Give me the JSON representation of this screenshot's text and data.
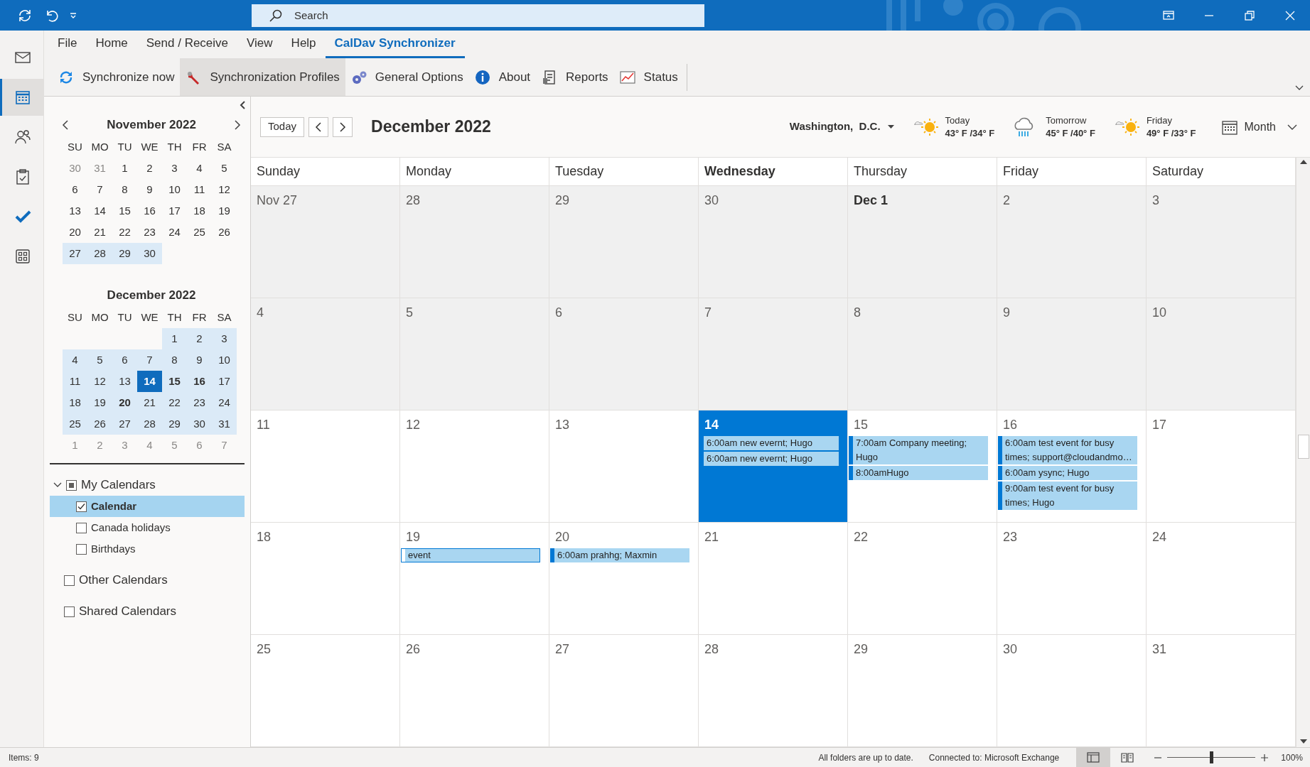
{
  "title_bar": {
    "search": {
      "placeholder": "Search"
    }
  },
  "nav_items": [
    {
      "kind": "mail",
      "selected": false
    },
    {
      "kind": "calendar",
      "selected": true
    },
    {
      "kind": "people",
      "selected": false
    },
    {
      "kind": "tasks",
      "selected": false
    },
    {
      "kind": "todo",
      "selected": false
    },
    {
      "kind": "apps",
      "selected": false
    }
  ],
  "menu_tabs": [
    {
      "label": "File",
      "selected": false
    },
    {
      "label": "Home",
      "selected": false
    },
    {
      "label": "Send / Receive",
      "selected": false
    },
    {
      "label": "View",
      "selected": false
    },
    {
      "label": "Help",
      "selected": false
    },
    {
      "label": "CalDav Synchronizer",
      "selected": true
    }
  ],
  "ribbon_buttons": [
    {
      "kind": "sync",
      "label": "Synchronize now",
      "hovered": false
    },
    {
      "kind": "wrench",
      "label": "Synchronization Profiles",
      "hovered": true
    },
    {
      "kind": "gears",
      "label": "General Options",
      "hovered": false
    },
    {
      "kind": "info",
      "label": "About",
      "hovered": false
    },
    {
      "kind": "reports",
      "label": "Reports",
      "hovered": false
    },
    {
      "kind": "status",
      "label": "Status",
      "hovered": false
    }
  ],
  "mini_calendars": [
    {
      "title": "November 2022",
      "weekdays": [
        "SU",
        "MO",
        "TU",
        "WE",
        "TH",
        "FR",
        "SA"
      ],
      "weeks": [
        [
          {
            "day": "30",
            "muted": true,
            "highlighted": false,
            "bold": false,
            "selected": false
          },
          {
            "day": "31",
            "muted": true,
            "highlighted": false,
            "bold": false,
            "selected": false
          },
          {
            "day": "1",
            "muted": false,
            "highlighted": false,
            "bold": false,
            "selected": false
          },
          {
            "day": "2",
            "muted": false,
            "highlighted": false,
            "bold": false,
            "selected": false
          },
          {
            "day": "3",
            "muted": false,
            "highlighted": false,
            "bold": false,
            "selected": false
          },
          {
            "day": "4",
            "muted": false,
            "highlighted": false,
            "bold": false,
            "selected": false
          },
          {
            "day": "5",
            "muted": false,
            "highlighted": false,
            "bold": false,
            "selected": false
          }
        ],
        [
          {
            "day": "6",
            "muted": false,
            "highlighted": false,
            "bold": false,
            "selected": false
          },
          {
            "day": "7",
            "muted": false,
            "highlighted": false,
            "bold": false,
            "selected": false
          },
          {
            "day": "8",
            "muted": false,
            "highlighted": false,
            "bold": false,
            "selected": false
          },
          {
            "day": "9",
            "muted": false,
            "highlighted": false,
            "bold": false,
            "selected": false
          },
          {
            "day": "10",
            "muted": false,
            "highlighted": false,
            "bold": false,
            "selected": false
          },
          {
            "day": "11",
            "muted": false,
            "highlighted": false,
            "bold": false,
            "selected": false
          },
          {
            "day": "12",
            "muted": false,
            "highlighted": false,
            "bold": false,
            "selected": false
          }
        ],
        [
          {
            "day": "13",
            "muted": false,
            "highlighted": false,
            "bold": false,
            "selected": false
          },
          {
            "day": "14",
            "muted": false,
            "highlighted": false,
            "bold": false,
            "selected": false
          },
          {
            "day": "15",
            "muted": false,
            "highlighted": false,
            "bold": false,
            "selected": false
          },
          {
            "day": "16",
            "muted": false,
            "highlighted": false,
            "bold": false,
            "selected": false
          },
          {
            "day": "17",
            "muted": false,
            "highlighted": false,
            "bold": false,
            "selected": false
          },
          {
            "day": "18",
            "muted": false,
            "highlighted": false,
            "bold": false,
            "selected": false
          },
          {
            "day": "19",
            "muted": false,
            "highlighted": false,
            "bold": false,
            "selected": false
          }
        ],
        [
          {
            "day": "20",
            "muted": false,
            "highlighted": false,
            "bold": false,
            "selected": false
          },
          {
            "day": "21",
            "muted": false,
            "highlighted": false,
            "bold": false,
            "selected": false
          },
          {
            "day": "22",
            "muted": false,
            "highlighted": false,
            "bold": false,
            "selected": false
          },
          {
            "day": "23",
            "muted": false,
            "highlighted": false,
            "bold": false,
            "selected": false
          },
          {
            "day": "24",
            "muted": false,
            "highlighted": false,
            "bold": false,
            "selected": false
          },
          {
            "day": "25",
            "muted": false,
            "highlighted": false,
            "bold": false,
            "selected": false
          },
          {
            "day": "26",
            "muted": false,
            "highlighted": false,
            "bold": false,
            "selected": false
          }
        ],
        [
          {
            "day": "27",
            "muted": false,
            "highlighted": true,
            "bold": false,
            "selected": false
          },
          {
            "day": "28",
            "muted": false,
            "highlighted": true,
            "bold": false,
            "selected": false
          },
          {
            "day": "29",
            "muted": false,
            "highlighted": true,
            "bold": false,
            "selected": false
          },
          {
            "day": "30",
            "muted": false,
            "highlighted": true,
            "bold": false,
            "selected": false
          }
        ]
      ]
    },
    {
      "title": "December 2022",
      "weekdays": [
        "SU",
        "MO",
        "TU",
        "WE",
        "TH",
        "FR",
        "SA"
      ],
      "weeks": [
        [
          {
            "day": "1",
            "muted": false,
            "highlighted": true,
            "bold": false,
            "selected": false
          },
          {
            "day": "2",
            "muted": false,
            "highlighted": true,
            "bold": false,
            "selected": false
          },
          {
            "day": "3",
            "muted": false,
            "highlighted": true,
            "bold": false,
            "selected": false
          }
        ],
        [
          {
            "day": "4",
            "muted": false,
            "highlighted": true,
            "bold": false,
            "selected": false
          },
          {
            "day": "5",
            "muted": false,
            "highlighted": true,
            "bold": false,
            "selected": false
          },
          {
            "day": "6",
            "muted": false,
            "highlighted": true,
            "bold": false,
            "selected": false
          },
          {
            "day": "7",
            "muted": false,
            "highlighted": true,
            "bold": false,
            "selected": false
          },
          {
            "day": "8",
            "muted": false,
            "highlighted": true,
            "bold": false,
            "selected": false
          },
          {
            "day": "9",
            "muted": false,
            "highlighted": true,
            "bold": false,
            "selected": false
          },
          {
            "day": "10",
            "muted": false,
            "highlighted": true,
            "bold": false,
            "selected": false
          }
        ],
        [
          {
            "day": "11",
            "muted": false,
            "highlighted": true,
            "bold": false,
            "selected": false
          },
          {
            "day": "12",
            "muted": false,
            "highlighted": true,
            "bold": false,
            "selected": false
          },
          {
            "day": "13",
            "muted": false,
            "highlighted": true,
            "bold": false,
            "selected": false
          },
          {
            "day": "14",
            "muted": false,
            "highlighted": true,
            "bold": true,
            "selected": true
          },
          {
            "day": "15",
            "muted": false,
            "highlighted": true,
            "bold": true,
            "selected": false
          },
          {
            "day": "16",
            "muted": false,
            "highlighted": true,
            "bold": true,
            "selected": false
          },
          {
            "day": "17",
            "muted": false,
            "highlighted": true,
            "bold": false,
            "selected": false
          }
        ],
        [
          {
            "day": "18",
            "muted": false,
            "highlighted": true,
            "bold": false,
            "selected": false
          },
          {
            "day": "19",
            "muted": false,
            "highlighted": true,
            "bold": false,
            "selected": false
          },
          {
            "day": "20",
            "muted": false,
            "highlighted": true,
            "bold": true,
            "selected": false
          },
          {
            "day": "21",
            "muted": false,
            "highlighted": true,
            "bold": false,
            "selected": false
          },
          {
            "day": "22",
            "muted": false,
            "highlighted": true,
            "bold": false,
            "selected": false
          },
          {
            "day": "23",
            "muted": false,
            "highlighted": true,
            "bold": false,
            "selected": false
          },
          {
            "day": "24",
            "muted": false,
            "highlighted": true,
            "bold": false,
            "selected": false
          }
        ],
        [
          {
            "day": "25",
            "muted": false,
            "highlighted": true,
            "bold": false,
            "selected": false
          },
          {
            "day": "26",
            "muted": false,
            "highlighted": true,
            "bold": false,
            "selected": false
          },
          {
            "day": "27",
            "muted": false,
            "highlighted": true,
            "bold": false,
            "selected": false
          },
          {
            "day": "28",
            "muted": false,
            "highlighted": true,
            "bold": false,
            "selected": false
          },
          {
            "day": "29",
            "muted": false,
            "highlighted": true,
            "bold": false,
            "selected": false
          },
          {
            "day": "30",
            "muted": false,
            "highlighted": true,
            "bold": false,
            "selected": false
          },
          {
            "day": "31",
            "muted": false,
            "highlighted": true,
            "bold": false,
            "selected": false
          }
        ],
        [
          {
            "day": "1",
            "muted": true,
            "highlighted": false,
            "bold": false,
            "selected": false
          },
          {
            "day": "2",
            "muted": true,
            "highlighted": false,
            "bold": false,
            "selected": false
          },
          {
            "day": "3",
            "muted": true,
            "highlighted": false,
            "bold": false,
            "selected": false
          },
          {
            "day": "4",
            "muted": true,
            "highlighted": false,
            "bold": false,
            "selected": false
          },
          {
            "day": "5",
            "muted": true,
            "highlighted": false,
            "bold": false,
            "selected": false
          },
          {
            "day": "6",
            "muted": true,
            "highlighted": false,
            "bold": false,
            "selected": false
          },
          {
            "day": "7",
            "muted": true,
            "highlighted": false,
            "bold": false,
            "selected": false
          }
        ]
      ]
    }
  ],
  "folders": [
    {
      "label": "My Calendars",
      "expanded": true,
      "checked": false,
      "indeterminate": true,
      "items": [
        {
          "label": "Calendar",
          "checked": true,
          "selected": true
        },
        {
          "label": "Canada holidays",
          "checked": false,
          "selected": false
        },
        {
          "label": "Birthdays",
          "checked": false,
          "selected": false
        }
      ]
    },
    {
      "label": "Other Calendars",
      "checked": false,
      "indeterminate": false
    },
    {
      "label": "Shared Calendars",
      "checked": false,
      "indeterminate": false
    }
  ],
  "calendar_header": {
    "today_button": "Today",
    "title": "December 2022",
    "location": "Washington,  D.C.",
    "forecast": [
      {
        "kind": "sunny",
        "day": "Today",
        "temps": "43° F /34° F"
      },
      {
        "kind": "rain",
        "day": "Tomorrow",
        "temps": "45° F /40° F"
      },
      {
        "kind": "sunny",
        "day": "Friday",
        "temps": "49° F /33° F"
      }
    ],
    "view": "Month"
  },
  "weekdays": [
    {
      "label": "Sunday",
      "today": false
    },
    {
      "label": "Monday",
      "today": false
    },
    {
      "label": "Tuesday",
      "today": false
    },
    {
      "label": "Wednesday",
      "today": true
    },
    {
      "label": "Thursday",
      "today": false
    },
    {
      "label": "Friday",
      "today": false
    },
    {
      "label": "Saturday",
      "today": false
    }
  ],
  "weeks": [
    [
      {
        "label": "Nov 27",
        "bold": false,
        "today": false,
        "past": true
      },
      {
        "label": "28",
        "bold": false,
        "today": false,
        "past": true
      },
      {
        "label": "29",
        "bold": false,
        "today": false,
        "past": true
      },
      {
        "label": "30",
        "bold": false,
        "today": false,
        "past": true
      },
      {
        "label": "Dec 1",
        "bold": true,
        "today": false,
        "past": true
      },
      {
        "label": "2",
        "bold": false,
        "today": false,
        "past": true
      },
      {
        "label": "3",
        "bold": false,
        "today": false,
        "past": true
      }
    ],
    [
      {
        "label": "4",
        "bold": false,
        "today": false,
        "past": true
      },
      {
        "label": "5",
        "bold": false,
        "today": false,
        "past": true
      },
      {
        "label": "6",
        "bold": false,
        "today": false,
        "past": true
      },
      {
        "label": "7",
        "bold": false,
        "today": false,
        "past": true
      },
      {
        "label": "8",
        "bold": false,
        "today": false,
        "past": true
      },
      {
        "label": "9",
        "bold": false,
        "today": false,
        "past": true
      },
      {
        "label": "10",
        "bold": false,
        "today": false,
        "past": true
      }
    ],
    [
      {
        "label": "11",
        "bold": false,
        "today": false,
        "past": false
      },
      {
        "label": "12",
        "bold": false,
        "today": false,
        "past": false
      },
      {
        "label": "13",
        "bold": false,
        "today": false,
        "past": false
      },
      {
        "label": "14",
        "bold": true,
        "today": true,
        "past": false,
        "events": [
          {
            "kind": "busy",
            "text": "6:00am new evernt; Hugo"
          },
          {
            "kind": "busy",
            "text": "6:00am new evernt; Hugo"
          }
        ]
      },
      {
        "label": "15",
        "bold": false,
        "today": false,
        "past": false,
        "events": [
          {
            "kind": "busy",
            "text": "7:00am Company meeting; Hugo"
          },
          {
            "kind": "busy",
            "text": "8:00amHugo"
          }
        ]
      },
      {
        "label": "16",
        "bold": false,
        "today": false,
        "past": false,
        "events": [
          {
            "kind": "busy",
            "text": "6:00am test event for busy times; support@cloudandmo…"
          },
          {
            "kind": "busy",
            "text": "6:00am ysync; Hugo"
          },
          {
            "kind": "busy",
            "text": "9:00am test event for busy times; Hugo"
          }
        ]
      },
      {
        "label": "17",
        "bold": false,
        "today": false,
        "past": false
      }
    ],
    [
      {
        "label": "18",
        "bold": false,
        "today": false,
        "past": false
      },
      {
        "label": "19",
        "bold": false,
        "today": false,
        "past": false,
        "events": [
          {
            "kind": "tentative",
            "text": "event"
          }
        ]
      },
      {
        "label": "20",
        "bold": false,
        "today": false,
        "past": false,
        "events": [
          {
            "kind": "busy",
            "text": "6:00am prahhg; Maxmin"
          }
        ]
      },
      {
        "label": "21",
        "bold": false,
        "today": false,
        "past": false
      },
      {
        "label": "22",
        "bold": false,
        "today": false,
        "past": false
      },
      {
        "label": "23",
        "bold": false,
        "today": false,
        "past": false
      },
      {
        "label": "24",
        "bold": false,
        "today": false,
        "past": false
      }
    ],
    [
      {
        "label": "25",
        "bold": false,
        "today": false,
        "past": false
      },
      {
        "label": "26",
        "bold": false,
        "today": false,
        "past": false
      },
      {
        "label": "27",
        "bold": false,
        "today": false,
        "past": false
      },
      {
        "label": "28",
        "bold": false,
        "today": false,
        "past": false
      },
      {
        "label": "29",
        "bold": false,
        "today": false,
        "past": false
      },
      {
        "label": "30",
        "bold": false,
        "today": false,
        "past": false
      },
      {
        "label": "31",
        "bold": false,
        "today": false,
        "past": false
      }
    ]
  ],
  "status_bar": {
    "items": "Items: 9",
    "sync_status": "All folders are up to date.",
    "connection": "Connected to: Microsoft Exchange",
    "views": [
      {
        "kind": "normal",
        "selected": true
      },
      {
        "kind": "reading",
        "selected": false
      }
    ],
    "zoom": {
      "level": 0.5,
      "reading": "100%"
    }
  }
}
